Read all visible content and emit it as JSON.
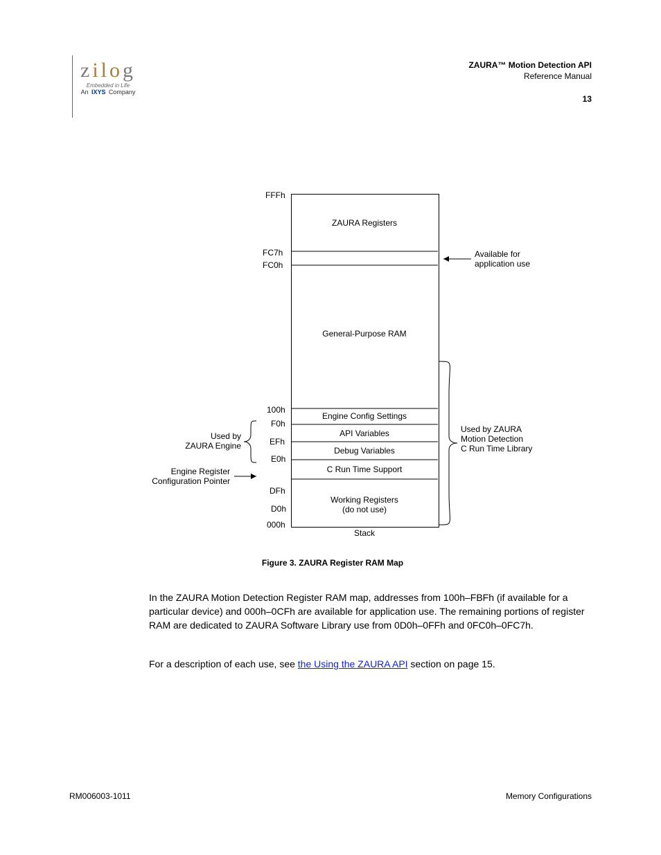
{
  "header": {
    "title": "ZAURA™ Motion Detection API",
    "subtitle": "Reference Manual",
    "pagenum": "13"
  },
  "logo": {
    "brand_letters": [
      "z",
      "i",
      "l",
      "o",
      "g"
    ],
    "sub1": "Embedded in Life",
    "sub2_pre": "An",
    "sub2_mid": "IXYS",
    "sub2_post": "Company"
  },
  "addrs": {
    "top": "FFFh",
    "fc7": "FC7h",
    "fc0": "FC0h",
    "l100": "100h",
    "lf0": "F0h",
    "lef": "EFh",
    "le0": "E0h",
    "ldf": "DFh",
    "ld0": "D0h",
    "l000": "000h"
  },
  "labels": {
    "zaura_reg": "ZAURA Registers",
    "avail_ram": "Available for\napplication use",
    "gpr": "General-Purpose RAM",
    "ercp": "Engine Register\nConfiguration Pointer",
    "left_upper": "Used by\nZAURA Engine",
    "left_lower": "Used by ZAURA\nMotion Detection\nC Run Time Library",
    "workregs": "Working Registers\n(do not use)",
    "stack": "Stack",
    "four_rows": [
      "Engine Config Settings",
      "API Variables",
      "Debug Variables",
      "C Run Time Support"
    ]
  },
  "caption": "Figure 3. ZAURA Register RAM Map",
  "para1": "In the ZAURA Motion Detection Register RAM map, addresses from 100h–FBFh (if available for a particular device) and 000h–0CFh are available for application use. The remaining portions of register RAM are dedicated to ZAURA Software Library use from 0D0h–0FFh and 0FC0h–0FC7h.",
  "para2": {
    "pre": "For a description of each use, see ",
    "link": "the Using the ZAURA API",
    "post": " section on page 15."
  },
  "footer": {
    "left": "RM006003-1011",
    "right": "Memory Configurations"
  }
}
